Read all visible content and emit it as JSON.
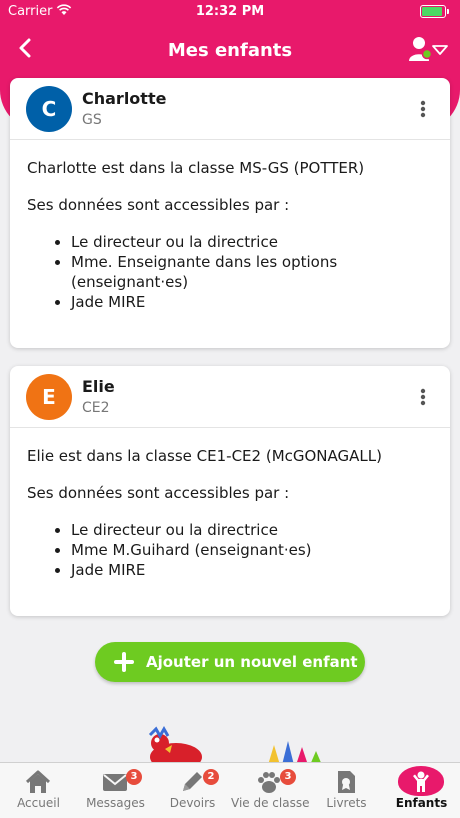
{
  "status_bar": {
    "carrier": "Carrier",
    "time": "12:32 PM",
    "battery": 0.85
  },
  "header": {
    "title": "Mes enfants"
  },
  "children": [
    {
      "initial": "C",
      "name": "Charlotte",
      "level": "GS",
      "color": "#0060a8",
      "class_text": "Charlotte est dans la classe MS-GS (POTTER)",
      "access_title": "Ses données sont accessibles par :",
      "access_list": [
        "Le directeur ou la directrice",
        "Mme. Enseignante dans les options (enseignant·es)",
        "Jade MIRE"
      ]
    },
    {
      "initial": "E",
      "name": "Elie",
      "level": "CE2",
      "color": "#f07314",
      "class_text": "Elie est dans la classe CE1-CE2 (McGONAGALL)",
      "access_title": "Ses données sont accessibles par :",
      "access_list": [
        "Le directeur ou la directrice",
        "Mme M.Guihard (enseignant·es)",
        "Jade MIRE"
      ]
    }
  ],
  "add_button": {
    "label": "Ajouter un nouvel enfant"
  },
  "tabs": [
    {
      "label": "Accueil",
      "icon": "home-icon"
    },
    {
      "label": "Messages",
      "icon": "envelope-icon",
      "badge": "3"
    },
    {
      "label": "Devoirs",
      "icon": "pencil-icon",
      "badge": "2"
    },
    {
      "label": "Vie de classe",
      "icon": "paw-icon",
      "badge": "3"
    },
    {
      "label": "Livrets",
      "icon": "booklet-icon"
    },
    {
      "label": "Enfants",
      "icon": "child-icon",
      "active": true
    }
  ],
  "colors": {
    "brand": "#e8196b",
    "add_button": "#6ecb21",
    "badge": "#e74c3c"
  }
}
